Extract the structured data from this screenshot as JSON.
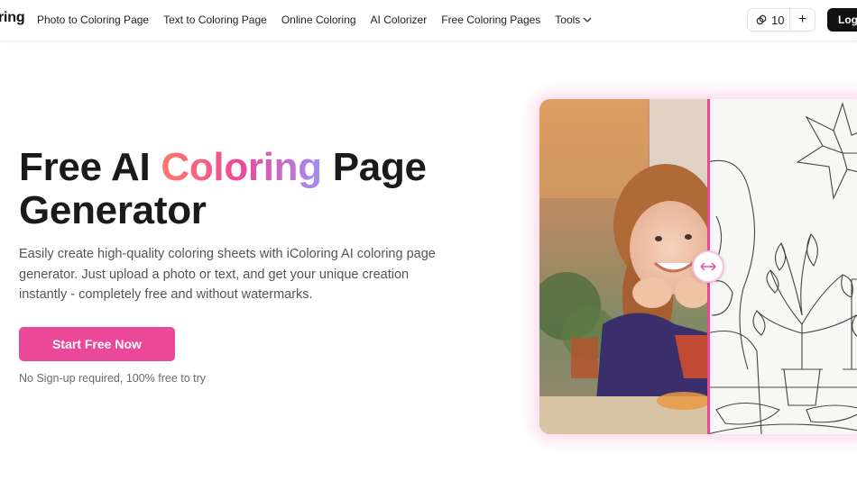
{
  "header": {
    "logo_text": "ring",
    "nav": [
      {
        "label": "Photo to Coloring Page"
      },
      {
        "label": "Text to Coloring Page"
      },
      {
        "label": "Online Coloring"
      },
      {
        "label": "AI Colorizer"
      },
      {
        "label": "Free Coloring Pages"
      }
    ],
    "tools_label": "Tools",
    "credits": "10",
    "plus_label": "+",
    "login_label": "Logi"
  },
  "hero": {
    "title_part1": "Free AI ",
    "title_highlight": "Coloring",
    "title_part2": " Page",
    "title_line2": "Generator",
    "description": "Easily create high-quality coloring sheets with iColoring AI coloring page generator. Just upload a photo or text, and get your unique creation instantly - completely free and without watermarks.",
    "cta_label": "Start Free Now",
    "cta_note": "No Sign-up required, 100% free to try"
  },
  "colors": {
    "accent": "#ec4899",
    "gradient": [
      "#ff7a6b",
      "#ec4899",
      "#a08ff0"
    ],
    "login_bg": "#111111"
  },
  "icons": {
    "credit": "coin-link-icon",
    "tools": "chevron-down-icon",
    "handle": "arrows-horizontal-icon"
  }
}
